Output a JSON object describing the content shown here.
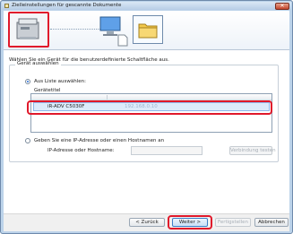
{
  "window": {
    "title": "Zielleinstellungen für gescannte Dokumente",
    "close_glyph": "✕"
  },
  "description": "Wählen Sie ein Gerät für die benutzerdefinierte Schaltfläche aus.",
  "device_group": {
    "legend": "Gerät auswählen",
    "from_list": {
      "label": "Aus Liste auswählen:",
      "selected": true
    },
    "device_list": {
      "header": "Gerätetitel",
      "rows": [
        {
          "name": "iR-ADV C5030F",
          "ip": "192.168.0.10"
        }
      ]
    },
    "from_ip": {
      "label": "Geben Sie eine IP-Adresse oder einen Hostnamen an",
      "selected": false,
      "field_label": "IP-Adresse oder Hostname:",
      "field_value": "",
      "verify_button": "Verbindung testen"
    }
  },
  "buttons": {
    "back": "< Zurück",
    "next": "Weiter >",
    "finish": "Fertigstellen",
    "cancel": "Abbrechen"
  },
  "icons": [
    "scanner-icon",
    "computer-icon",
    "document-icon",
    "folder-icon"
  ],
  "colors": {
    "highlight": "#e0192b",
    "selection": "#dcebfb",
    "window_frame": "#bcd3ea"
  }
}
